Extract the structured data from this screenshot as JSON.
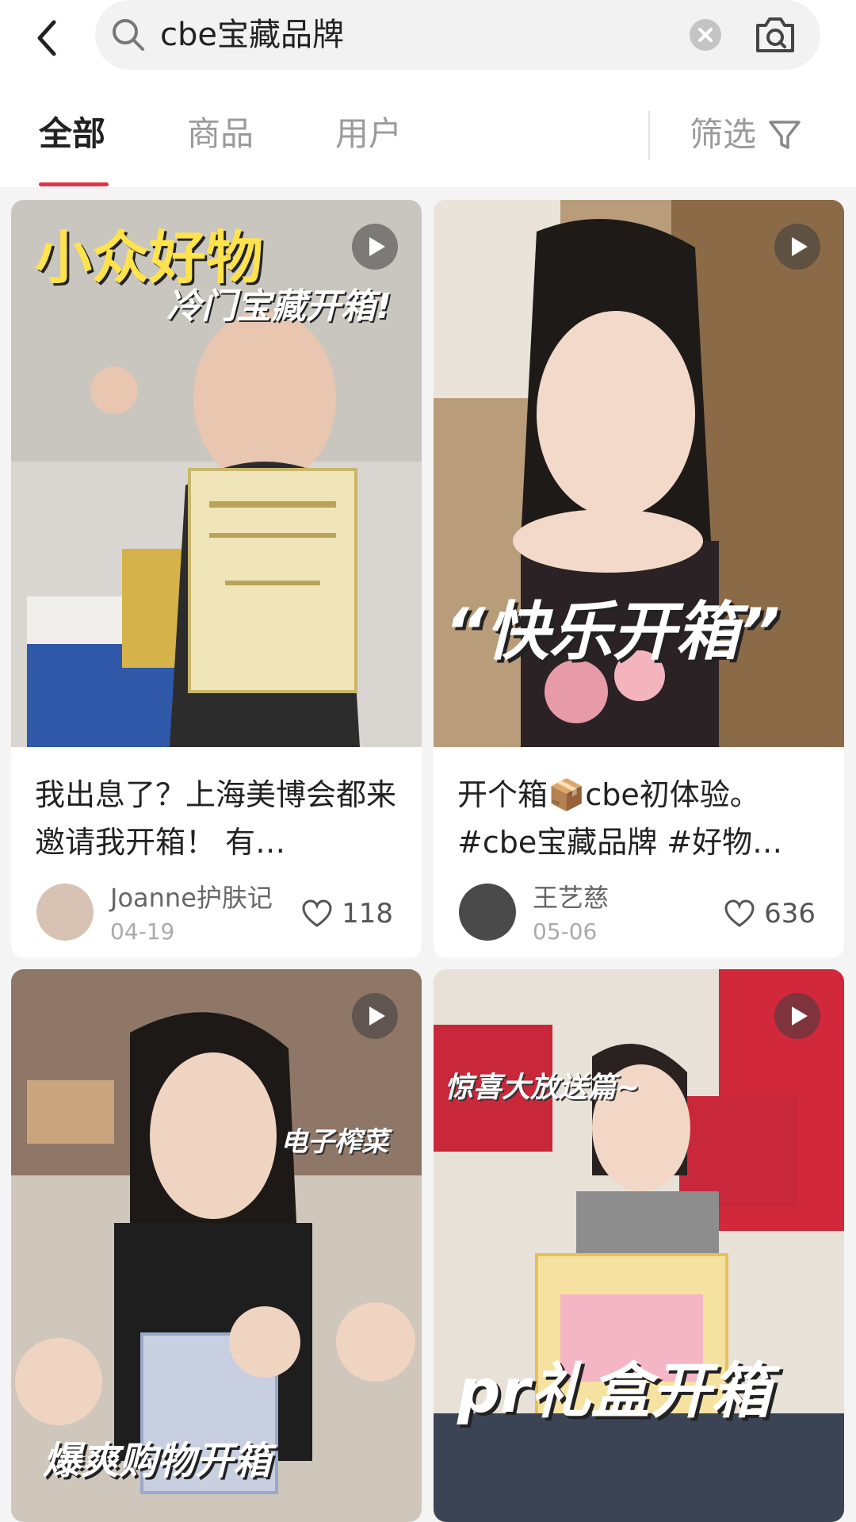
{
  "header": {
    "search_query": "cbe宝藏品牌"
  },
  "tabs": [
    {
      "label": "全部",
      "active": true
    },
    {
      "label": "商品",
      "active": false
    },
    {
      "label": "用户",
      "active": false
    }
  ],
  "filter": {
    "label": "筛选"
  },
  "accent_color": "#e2334b",
  "cards": [
    {
      "overlay_text_1": "小众好物",
      "overlay_text_2": "冷门宝藏开箱!",
      "title": "我出息了？上海美博会都来邀请我开箱！ 有…",
      "author": "Joanne护肤记",
      "date": "04-19",
      "likes": "118"
    },
    {
      "overlay_text_1": "“快乐开箱”",
      "title": "开个箱📦cbe初体验。#cbe宝藏品牌 #好物…",
      "author": "王艺慈",
      "date": "05-06",
      "likes": "636"
    },
    {
      "overlay_text_1": "电子榨菜",
      "overlay_text_2": "爆爽购物开箱"
    },
    {
      "overlay_text_1": "惊喜大放送篇~",
      "overlay_text_2": "pr礼盒开箱"
    }
  ]
}
